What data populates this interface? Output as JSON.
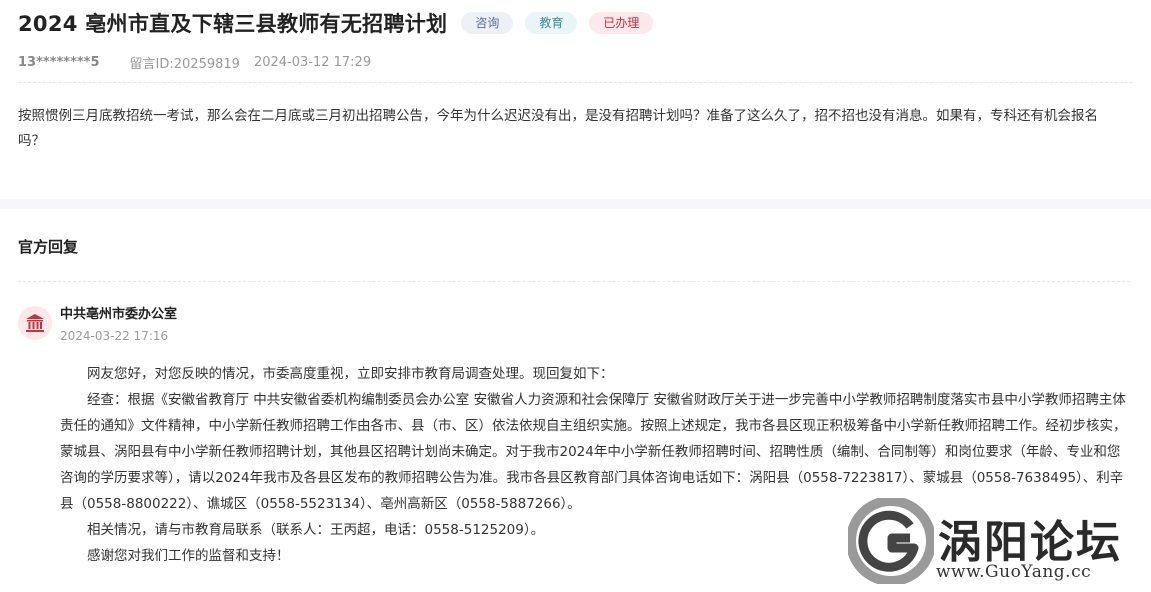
{
  "header": {
    "title": "2024 亳州市直及下辖三县教师有无招聘计划",
    "tags": [
      "咨询",
      "教育",
      "已办理"
    ]
  },
  "meta": {
    "user": "13********5",
    "message_id": "留言ID:20259819",
    "datetime": "2024-03-12 17:29"
  },
  "question": "按照惯例三月底教招统一考试，那么会在二月底或三月初出招聘公告，今年为什么迟迟没有出，是没有招聘计划吗？准备了这么久了，招不招也没有消息。如果有，专科还有机会报名吗？",
  "official": {
    "section_title": "官方回复",
    "org_name": "中共亳州市委办公室",
    "org_icon": "government-building-icon",
    "reply_date": "2024-03-22 17:16",
    "paragraphs": [
      "网友您好，对您反映的情况，市委高度重视，立即安排市教育局调查处理。现回复如下：",
      "经查：根据《安徽省教育厅 中共安徽省委机构编制委员会办公室 安徽省人力资源和社会保障厅 安徽省财政厅关于进一步完善中小学教师招聘制度落实市县中小学教师招聘主体责任的通知》文件精神，中小学新任教师招聘工作由各市、县（市、区）依法依规自主组织实施。按照上述规定，我市各县区现正积极筹备中小学新任教师招聘工作。经初步核实，蒙城县、涡阳县有中小学新任教师招聘计划，其他县区招聘计划尚未确定。对于我市2024年中小学新任教师招聘时间、招聘性质（编制、合同制等）和岗位要求（年龄、专业和您咨询的学历要求等），请以2024年我市及各县区发布的教师招聘公告为准。我市各县区教育部门具体咨询电话如下：涡阳县（0558-7223817）、蒙城县（0558-7638495）、利辛县（0558-8800222）、谯城区（0558-5523134）、亳州高新区（0558-5887266）。",
      "相关情况，请与市教育局联系（联系人：王丙超，电话：0558-5125209）。",
      "感谢您对我们工作的监督和支持！"
    ]
  },
  "watermark": {
    "text": "涡阳论坛",
    "url": "www.GuoYang.cc"
  }
}
